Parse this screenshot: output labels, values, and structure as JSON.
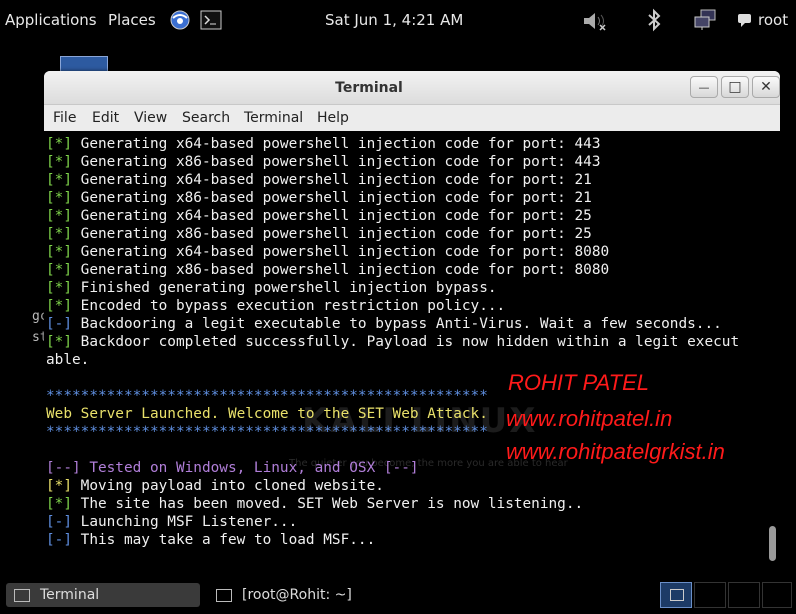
{
  "top_panel": {
    "applications": "Applications",
    "places": "Places",
    "clock": "Sat Jun  1,  4:21 AM",
    "user": "root"
  },
  "desktop": {
    "labels": [
      "gc",
      "st"
    ]
  },
  "window": {
    "title": "Terminal",
    "controls": {
      "minimize": "—",
      "maximize": "□",
      "close": "✕"
    },
    "menu": [
      "File",
      "Edit",
      "View",
      "Search",
      "Terminal",
      "Help"
    ]
  },
  "terminal": {
    "watermark": "KALI LINUX",
    "watermark_quote": "The quieter you become, the more you are able to hear",
    "lines": [
      {
        "tag": "[*]",
        "text": " Generating x64-based powershell injection code for port: 443",
        "c": "g"
      },
      {
        "tag": "[*]",
        "text": " Generating x86-based powershell injection code for port: 443",
        "c": "g"
      },
      {
        "tag": "[*]",
        "text": " Generating x64-based powershell injection code for port: 21",
        "c": "g"
      },
      {
        "tag": "[*]",
        "text": " Generating x86-based powershell injection code for port: 21",
        "c": "g"
      },
      {
        "tag": "[*]",
        "text": " Generating x64-based powershell injection code for port: 25",
        "c": "g"
      },
      {
        "tag": "[*]",
        "text": " Generating x86-based powershell injection code for port: 25",
        "c": "g"
      },
      {
        "tag": "[*]",
        "text": " Generating x64-based powershell injection code for port: 8080",
        "c": "g"
      },
      {
        "tag": "[*]",
        "text": " Generating x86-based powershell injection code for port: 8080",
        "c": "g"
      },
      {
        "tag": "[*]",
        "text": " Finished generating powershell injection bypass.",
        "c": "g"
      },
      {
        "tag": "[*]",
        "text": " Encoded to bypass execution restriction policy...",
        "c": "g"
      },
      {
        "tag": "[-]",
        "text": " Backdooring a legit executable to bypass Anti-Virus. Wait a few seconds...",
        "c": "b"
      },
      {
        "tag": "[*]",
        "text": " Backdoor completed successfully. Payload is now hidden within a legit execut",
        "c": "g"
      },
      {
        "tag": "",
        "text": "able.",
        "c": "w"
      },
      {
        "tag": "",
        "text": "",
        "c": "w"
      },
      {
        "tag": "",
        "text": "***************************************************",
        "c": "b"
      },
      {
        "tag": "",
        "text": "Web Server Launched. Welcome to the SET Web Attack.",
        "c": "y"
      },
      {
        "tag": "",
        "text": "***************************************************",
        "c": "b"
      },
      {
        "tag": "",
        "text": "",
        "c": "w"
      },
      {
        "tag": "",
        "text": "[--] Tested on Windows, Linux, and OSX [--]",
        "c": "p"
      },
      {
        "tag": "[*]",
        "text": " Moving payload into cloned website.",
        "c": "y"
      },
      {
        "tag": "[*]",
        "text": " The site has been moved. SET Web Server is now listening..",
        "c": "g"
      },
      {
        "tag": "[-]",
        "text": " Launching MSF Listener...",
        "c": "b"
      },
      {
        "tag": "[-]",
        "text": " This may take a few to load MSF...",
        "c": "b"
      }
    ]
  },
  "overlay": {
    "name": "ROHIT PATEL",
    "site1": "www.rohitpatel.in",
    "site2": "www.rohitpatelgrkist.in"
  },
  "taskbar": {
    "items": [
      {
        "label": "Terminal"
      },
      {
        "label": "[root@Rohit: ~]"
      }
    ]
  },
  "colors": {
    "green": "#7fd34a",
    "blue": "#5f8fe0",
    "yellow": "#e8e06a",
    "purple": "#b07ed8",
    "overlay_red": "#ff1a1a"
  }
}
